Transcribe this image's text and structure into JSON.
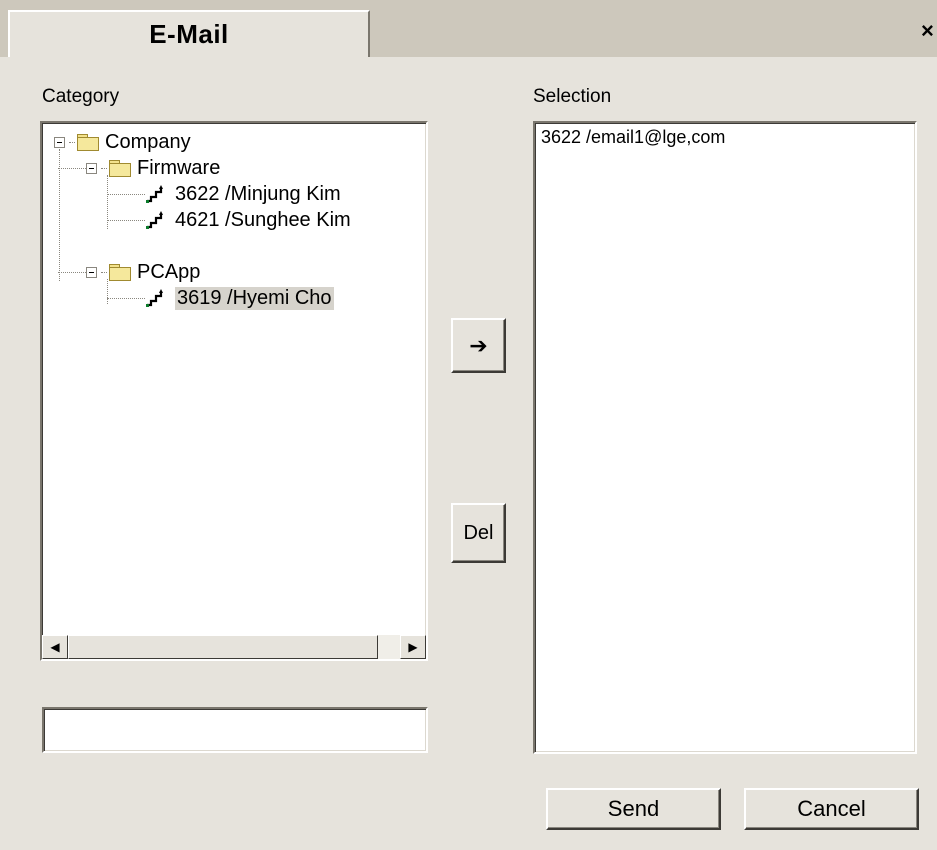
{
  "window": {
    "title": "E-Mail",
    "close_glyph": "×"
  },
  "category": {
    "label": "Category",
    "tree": {
      "root": {
        "label": "Company",
        "icon": "folder-icon"
      },
      "groups": [
        {
          "label": "Firmware",
          "icon": "folder-icon",
          "items": [
            {
              "label": "3622 /Minjung Kim",
              "icon": "person-icon"
            },
            {
              "label": "4621 /Sunghee Kim",
              "icon": "person-icon"
            }
          ]
        },
        {
          "label": "PCApp",
          "icon": "folder-icon",
          "items": [
            {
              "label": "3619 /Hyemi Cho",
              "icon": "person-icon",
              "selected": true
            }
          ]
        }
      ]
    },
    "scroll_left_glyph": "◀",
    "scroll_right_glyph": "▶",
    "input_value": ""
  },
  "selection": {
    "label": "Selection",
    "items": [
      "3622 /email1@lge,com"
    ]
  },
  "buttons": {
    "add_glyph": "➔",
    "del": "Del",
    "send": "Send",
    "cancel": "Cancel"
  }
}
